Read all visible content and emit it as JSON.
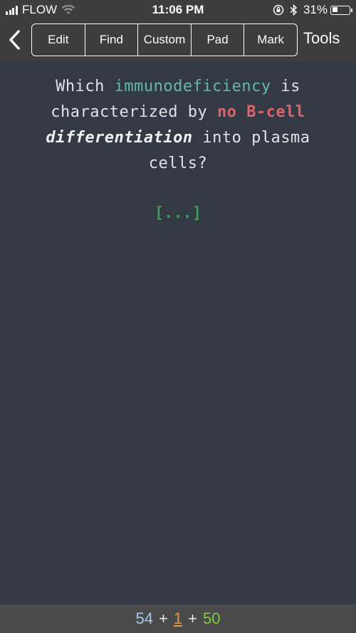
{
  "status_bar": {
    "carrier": "FLOW",
    "time": "11:06 PM",
    "battery_percent": "31%",
    "battery_level": 0.31,
    "icons": [
      "signal-icon",
      "wifi-icon",
      "rotation-lock-icon",
      "bluetooth-icon",
      "battery-icon"
    ]
  },
  "toolbar": {
    "back_icon": "chevron-left-icon",
    "segments": [
      "Edit",
      "Find",
      "Custom",
      "Pad",
      "Mark"
    ],
    "tools_label": "Tools"
  },
  "card": {
    "q_part1": "Which ",
    "q_term": "immunodeficiency",
    "q_part2": " is characterized by ",
    "q_emph": "no B-cell",
    "q_part3": " ",
    "q_italic": "differentiation",
    "q_part4": " into plasma cells?",
    "cloze": "[...]"
  },
  "counts": {
    "new": "54",
    "learning": "1",
    "review": "50",
    "separator": "+"
  },
  "colors": {
    "background": "#343a43",
    "bar": "#3d3d3d",
    "term": "#64b8a8",
    "emphasis": "#d9656a",
    "cloze": "#3e9a5a",
    "new": "#a8c8e8",
    "learning": "#e59a3e",
    "review": "#7ccb3a"
  }
}
